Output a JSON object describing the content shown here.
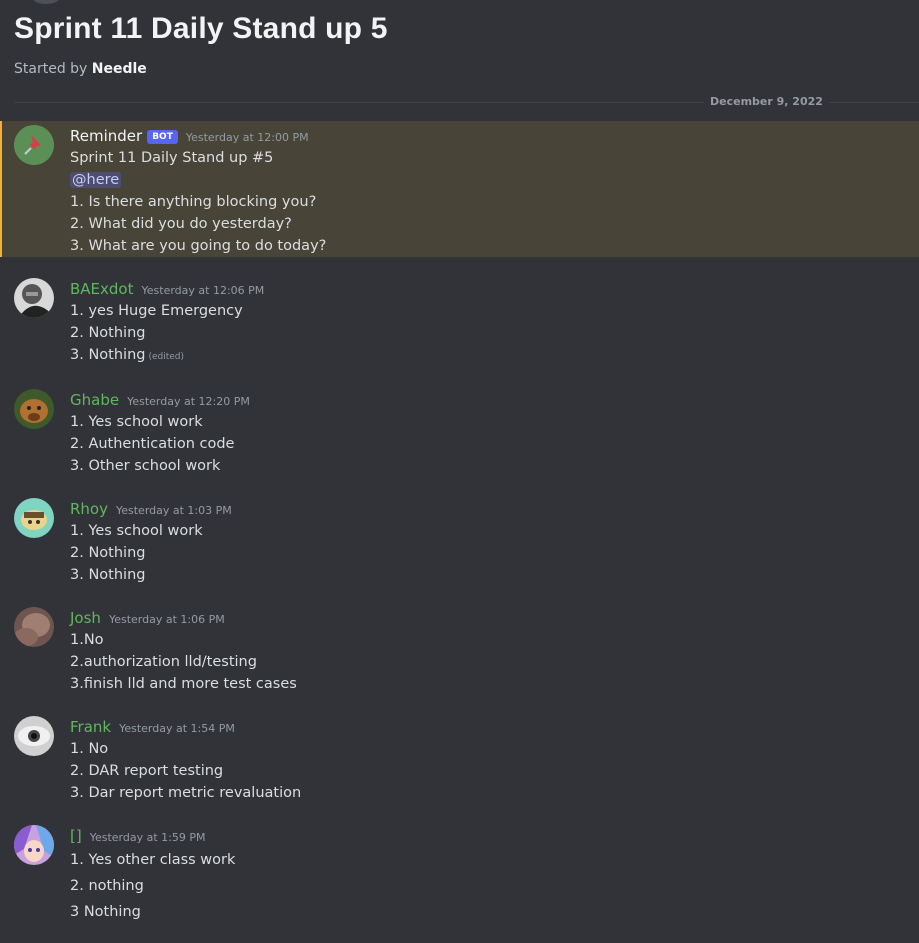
{
  "thread": {
    "title": "Sprint 11 Daily Stand up 5",
    "started_by_label": "Started by",
    "started_by_user": "Needle"
  },
  "divider": {
    "date": "December 9, 2022"
  },
  "messages": [
    {
      "author": "Reminder",
      "author_color": "#dbdee1",
      "bot_tag": "BOT",
      "timestamp": "Yesterday at 12:00 PM",
      "lines": [
        "Sprint 11 Daily Stand up #5",
        "@here",
        "1. Is there anything blocking you?",
        "2. What did you do yesterday?",
        "3. What are you going to do today?"
      ],
      "avatar": "pushpin-icon"
    },
    {
      "author": "BAExdot",
      "author_color": "#5fb85f",
      "timestamp": "Yesterday at 12:06 PM",
      "lines": [
        "1. yes Huge Emergency",
        "2. Nothing",
        "3. Nothing"
      ],
      "edited": "(edited)",
      "avatar": "portrait-avatar"
    },
    {
      "author": "Ghabe",
      "author_color": "#5fb85f",
      "timestamp": "Yesterday at 12:20 PM",
      "lines": [
        "1. Yes school work",
        "2. Authentication code",
        "3. Other school work"
      ],
      "avatar": "dog-avatar"
    },
    {
      "author": "Rhoy",
      "author_color": "#5fb85f",
      "timestamp": "Yesterday at 1:03 PM",
      "lines": [
        "1. Yes school work",
        "2. Nothing",
        "3. Nothing"
      ],
      "avatar": "cartoon-avatar"
    },
    {
      "author": "Josh",
      "author_color": "#5fb85f",
      "timestamp": "Yesterday at 1:06 PM",
      "lines": [
        "1.No",
        "2.authorization lld/testing",
        "3.finish lld and more test cases"
      ],
      "avatar": "photo-avatar"
    },
    {
      "author": "Frank",
      "author_color": "#5fb85f",
      "timestamp": "Yesterday at 1:54 PM",
      "lines": [
        "1. No",
        "2. DAR report testing",
        "3. Dar report metric revaluation"
      ],
      "avatar": "eye-avatar"
    },
    {
      "author": "[]",
      "author_color": "#5fb85f",
      "timestamp": "Yesterday at 1:59 PM",
      "lines": [
        "1. Yes other class work",
        "2. nothing",
        "3 Nothing"
      ],
      "avatar": "anime-avatar"
    }
  ]
}
